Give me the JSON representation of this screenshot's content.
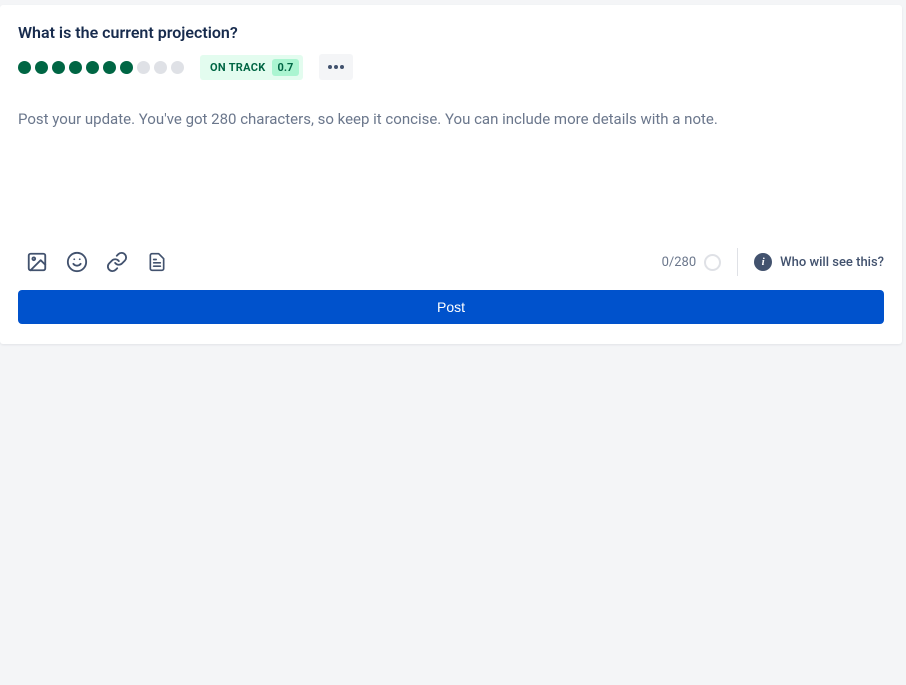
{
  "card": {
    "title": "What is the current projection?",
    "progress": {
      "filled": 7,
      "total": 10
    },
    "status": {
      "label": "ON TRACK",
      "value": "0.7"
    },
    "placeholder": "Post your update. You've got 280 characters, so keep it concise. You can include more details with a note.",
    "char_count": "0/280",
    "who_sees_label": "Who will see this?",
    "post_label": "Post"
  },
  "icons": {
    "image": "image-icon",
    "emoji": "emoji-icon",
    "link": "link-icon",
    "note": "note-icon",
    "more": "more-icon",
    "info": "info-icon"
  }
}
